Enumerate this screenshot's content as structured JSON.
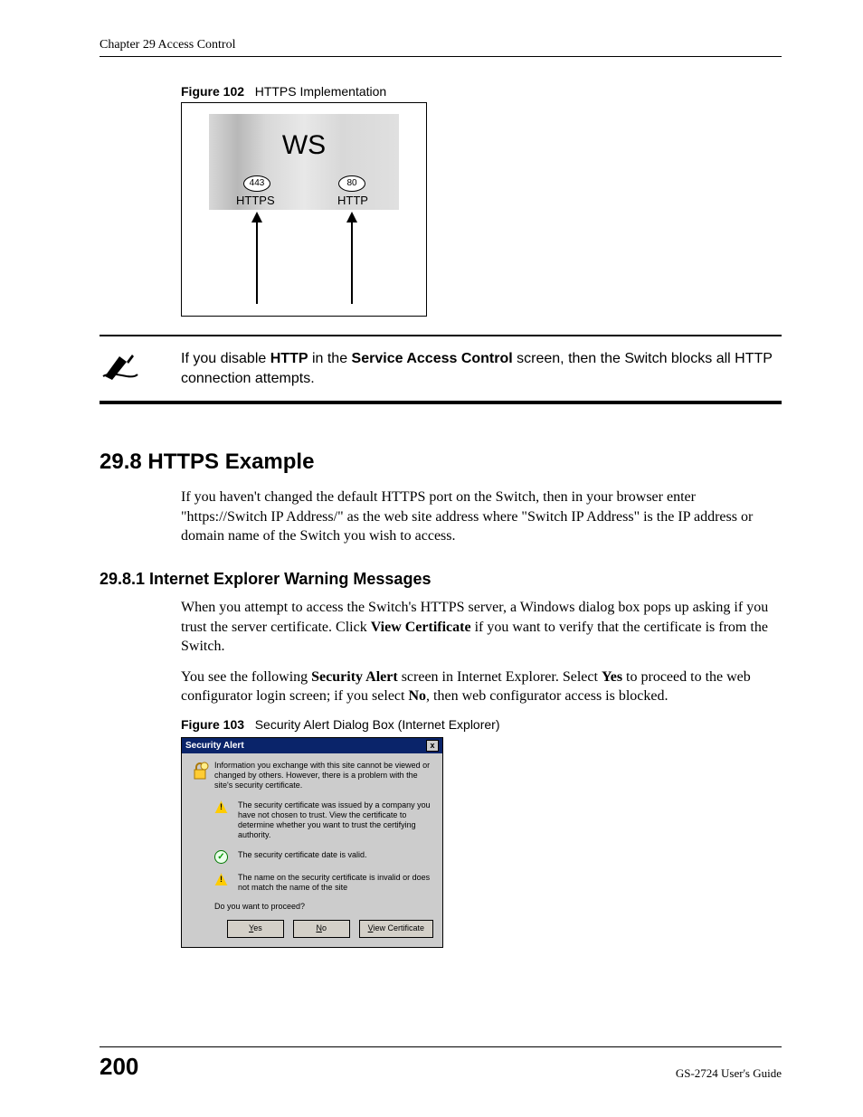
{
  "header": {
    "chapter": "Chapter 29 Access Control"
  },
  "figure102": {
    "caption_label": "Figure 102",
    "caption_text": "HTTPS Implementation",
    "ws": "WS",
    "port443": "443",
    "port80": "80",
    "https": "HTTPS",
    "http": "HTTP"
  },
  "note": {
    "pre": "If you disable ",
    "b1": "HTTP",
    "mid": " in the ",
    "b2": "Service Access Control",
    "post": " screen, then the Switch blocks all HTTP connection attempts."
  },
  "section298": {
    "heading": "29.8  HTTPS Example",
    "para": "If you haven't changed the default HTTPS port on the Switch, then in your browser enter \"https://Switch IP Address/\" as the web site address where \"Switch IP Address\" is the IP address or domain name of the Switch you wish to access."
  },
  "section2981": {
    "heading": "29.8.1  Internet Explorer Warning Messages",
    "para1_a": "When you attempt to access the Switch's HTTPS server, a Windows dialog box pops up asking if you trust the server certificate. Click ",
    "para1_b": "View Certificate",
    "para1_c": " if you want to verify that the certificate is from the Switch.",
    "para2_a": "You see the following ",
    "para2_b": "Security Alert",
    "para2_c": " screen in Internet Explorer. Select ",
    "para2_d": "Yes",
    "para2_e": " to proceed to the web configurator login screen; if you select ",
    "para2_f": "No",
    "para2_g": ", then web configurator access is blocked."
  },
  "figure103": {
    "caption_label": "Figure 103",
    "caption_text": "Security Alert Dialog Box (Internet Explorer)"
  },
  "dialog": {
    "title": "Security Alert",
    "close": "x",
    "intro": "Information you exchange with this site cannot be viewed or changed by others. However, there is a problem with the site's security certificate.",
    "item1": "The security certificate was issued by a company you have not chosen to trust. View the certificate to determine whether you want to trust the certifying authority.",
    "item2": "The security certificate date is valid.",
    "item3": "The name on the security certificate is invalid or does not match the name of the site",
    "question": "Do you want to proceed?",
    "yes_u": "Y",
    "yes_rest": "es",
    "no_u": "N",
    "no_rest": "o",
    "view_u": "V",
    "view_rest": "iew Certificate"
  },
  "footer": {
    "page": "200",
    "guide": "GS-2724 User's Guide"
  }
}
